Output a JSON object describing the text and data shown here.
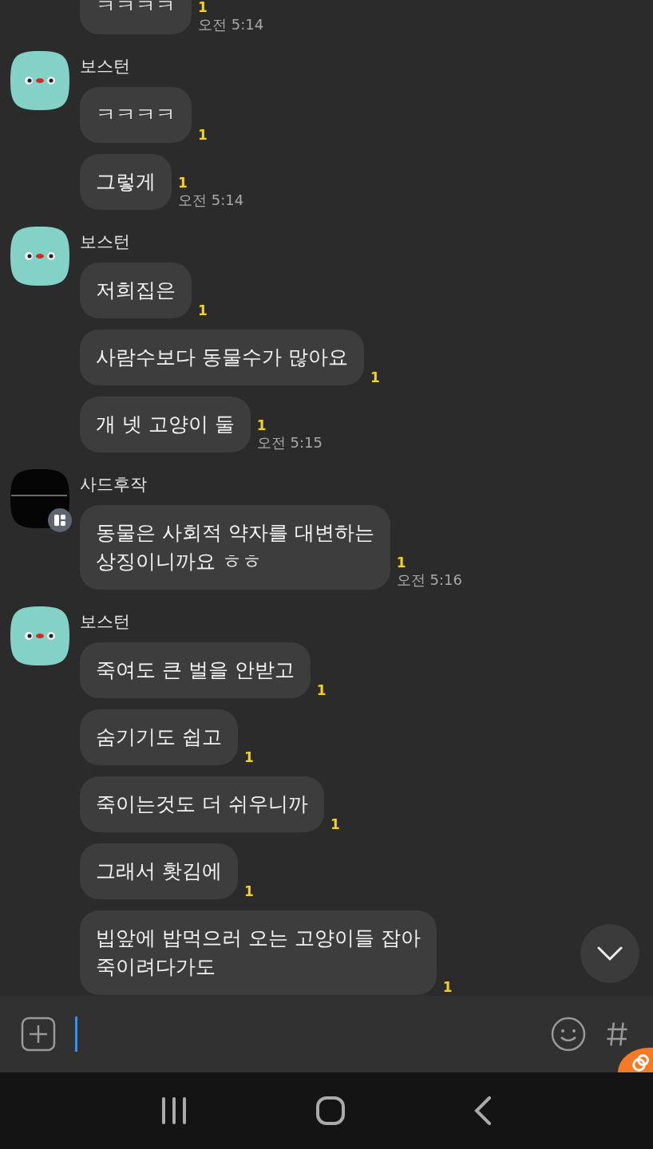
{
  "groups": [
    {
      "messages": [
        {
          "text": "ㅋㅋㅋㅋ",
          "unread": "1",
          "time": "오전 5:14"
        }
      ]
    },
    {
      "sender": "보스턴",
      "avatar": {
        "kind": "mint",
        "badge": false
      },
      "messages": [
        {
          "text": "ㅋㅋㅋㅋ",
          "unread": "1"
        },
        {
          "text": "그렇게",
          "unread": "1",
          "time": "오전 5:14"
        }
      ]
    },
    {
      "sender": "보스턴",
      "avatar": {
        "kind": "mint",
        "badge": false
      },
      "messages": [
        {
          "text": "저희집은",
          "unread": "1"
        },
        {
          "text": "사람수보다 동물수가 많아요",
          "unread": "1"
        },
        {
          "text": "개 넷 고양이 둘",
          "unread": "1",
          "time": "오전 5:15"
        }
      ]
    },
    {
      "sender": "사드후작",
      "avatar": {
        "kind": "picture",
        "badge": true
      },
      "messages": [
        {
          "text": "동물은 사회적 약자를 대변하는\n상징이니까요 ㅎㅎ",
          "unread": "1",
          "time": "오전 5:16"
        }
      ]
    },
    {
      "sender": "보스턴",
      "avatar": {
        "kind": "mint",
        "badge": false
      },
      "messages": [
        {
          "text": "죽여도 큰 벌을 안받고",
          "unread": "1"
        },
        {
          "text": "숨기기도 쉽고",
          "unread": "1"
        },
        {
          "text": "죽이는것도 더 쉬우니까",
          "unread": "1"
        },
        {
          "text": "그래서 홧김에",
          "unread": "1"
        },
        {
          "text": "빕앞에 밥먹으러 오는 고양이들 잡아\n죽이려다가도",
          "unread": "1"
        }
      ]
    }
  ]
}
